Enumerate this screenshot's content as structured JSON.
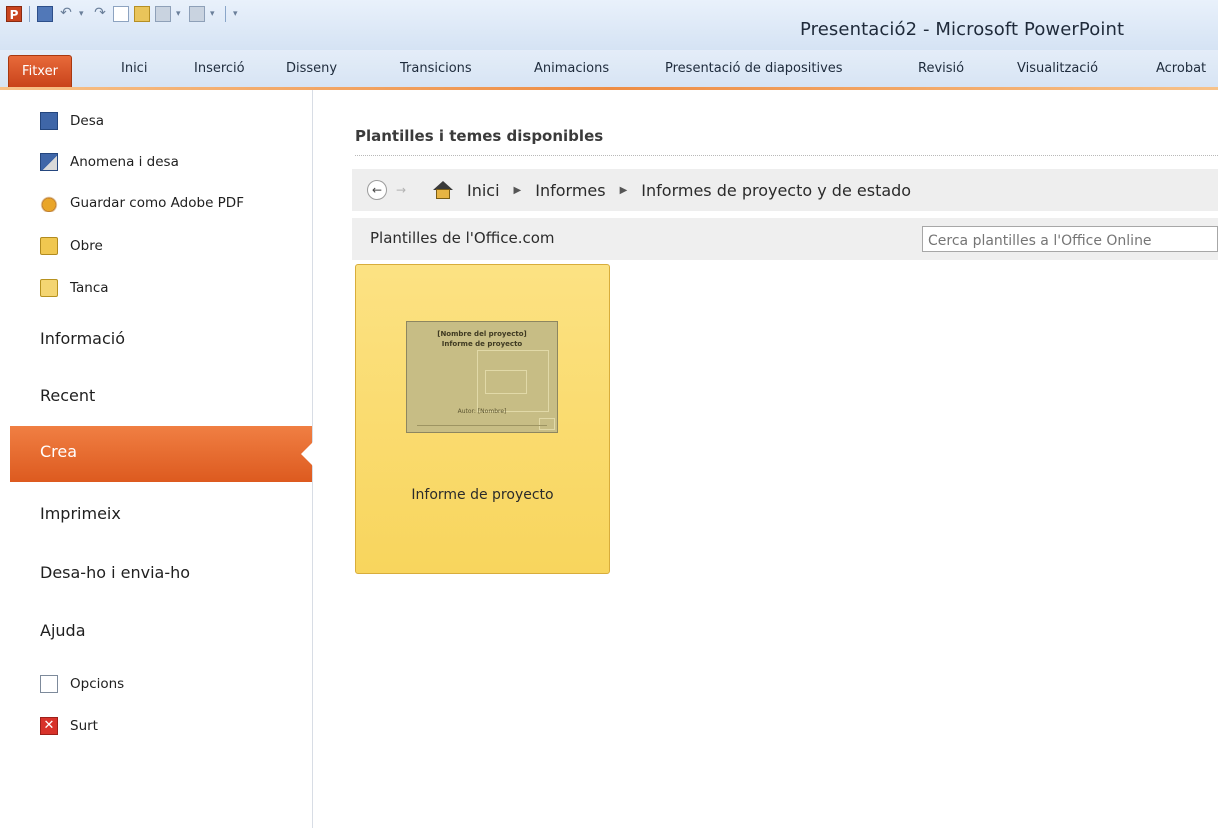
{
  "window": {
    "title": "Presentació2 - Microsoft PowerPoint",
    "app_icon": "P"
  },
  "qat": {
    "undo": "↶",
    "redo": "↷"
  },
  "ribbon": {
    "file_tab": "Fitxer",
    "tabs": [
      "Inici",
      "Inserció",
      "Disseny",
      "Transicions",
      "Animacions",
      "Presentació de diapositives",
      "Revisió",
      "Visualització",
      "Acrobat"
    ]
  },
  "backstage_nav": {
    "commands": {
      "save": "Desa",
      "save_as": "Anomena i desa",
      "save_pdf": "Guardar como Adobe PDF",
      "open": "Obre",
      "close": "Tanca"
    },
    "sections": {
      "info": "Informació",
      "recent": "Recent",
      "new": "Crea",
      "print": "Imprimeix",
      "share": "Desa-ho i envia-ho",
      "help": "Ajuda"
    },
    "bottom": {
      "options": "Opcions",
      "exit": "Surt",
      "exit_glyph": "✕"
    },
    "active": "Crea"
  },
  "main": {
    "heading": "Plantilles i temes disponibles",
    "breadcrumb": {
      "back": "←",
      "forward": "→",
      "items": [
        "Inici",
        "Informes",
        "Informes de proyecto y de estado"
      ],
      "separator": "▶"
    },
    "office_bar": {
      "label": "Plantilles de l'Office.com",
      "search_placeholder": "Cerca plantilles a l'Office Online"
    },
    "template": {
      "name": "Informe de proyecto",
      "thumb_line1": "[Nombre del proyecto]",
      "thumb_line2": "Informe de proyecto",
      "thumb_author": "Autor: [Nombre]"
    }
  },
  "colors": {
    "accent_orange": "#dd5a1f",
    "selected_template": "#f8d55d",
    "title_bar": "#d5e3f4"
  }
}
